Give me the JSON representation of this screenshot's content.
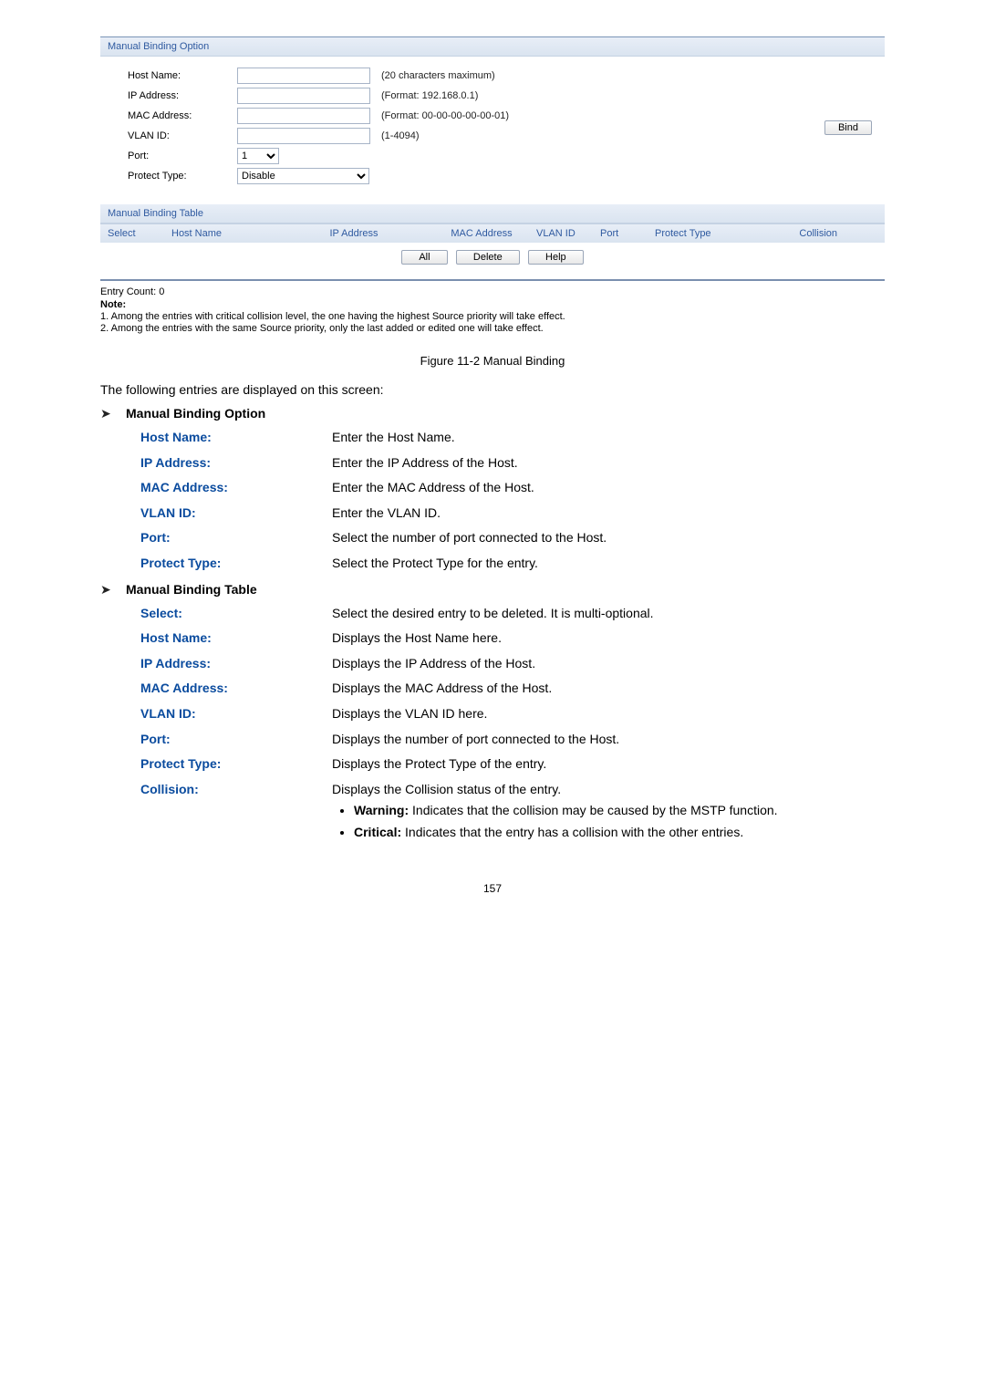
{
  "panel": {
    "option_title": "Manual Binding Option",
    "fields": {
      "host_name_label": "Host Name:",
      "host_name_hint": "(20 characters maximum)",
      "ip_label": "IP Address:",
      "ip_hint": "(Format: 192.168.0.1)",
      "mac_label": "MAC Address:",
      "mac_hint": "(Format: 00-00-00-00-00-01)",
      "vlan_label": "VLAN ID:",
      "vlan_hint": "(1-4094)",
      "port_label": "Port:",
      "port_value": "1",
      "ptype_label": "Protect Type:",
      "ptype_value": "Disable"
    },
    "bind_button": "Bind",
    "table_title": "Manual Binding Table",
    "columns": {
      "select": "Select",
      "hostname": "Host Name",
      "ip": "IP Address",
      "mac": "MAC Address",
      "vlan": "VLAN ID",
      "port": "Port",
      "ptype": "Protect Type",
      "collision": "Collision"
    },
    "buttons": {
      "all": "All",
      "delete": "Delete",
      "help": "Help"
    },
    "entry_count": "Entry Count: 0",
    "note_title": "Note:",
    "note1": "1. Among the entries with critical collision level, the one having the highest Source priority will take effect.",
    "note2": "2. Among the entries with the same Source priority, only the last added or edited one will take effect."
  },
  "figure_caption": "Figure 11-2 Manual Binding",
  "intro": "The following entries are displayed on this screen:",
  "section1": {
    "title": "Manual Binding Option",
    "fields": [
      {
        "label": "Host Name:",
        "desc": "Enter the Host Name."
      },
      {
        "label": "IP Address:",
        "desc": "Enter the IP Address of the Host."
      },
      {
        "label": "MAC Address:",
        "desc": "Enter the MAC Address of the Host."
      },
      {
        "label": "VLAN ID:",
        "desc": "Enter the VLAN ID."
      },
      {
        "label": "Port:",
        "desc": "Select the number of port connected to the Host."
      },
      {
        "label": "Protect Type:",
        "desc": "Select the Protect Type for the entry."
      }
    ]
  },
  "section2": {
    "title": "Manual Binding Table",
    "fields": [
      {
        "label": "Select:",
        "desc": "Select the desired entry to be deleted. It is multi-optional."
      },
      {
        "label": "Host Name:",
        "desc": "Displays the Host Name here."
      },
      {
        "label": "IP Address:",
        "desc": "Displays the IP Address of the Host."
      },
      {
        "label": "MAC Address:",
        "desc": "Displays the MAC Address of the Host."
      },
      {
        "label": "VLAN ID:",
        "desc": "Displays the VLAN ID here."
      },
      {
        "label": "Port:",
        "desc": "Displays the number of port connected to the Host."
      },
      {
        "label": "Protect Type:",
        "desc": "Displays the Protect Type of the entry."
      }
    ],
    "collision_label": "Collision:",
    "collision_desc": "Displays the Collision status of the entry.",
    "bullets": [
      {
        "b": "Warning:",
        "t": " Indicates that the collision may be caused by the MSTP function."
      },
      {
        "b": "Critical:",
        "t": " Indicates that the entry has a collision with the other entries."
      }
    ]
  },
  "page_number": "157"
}
